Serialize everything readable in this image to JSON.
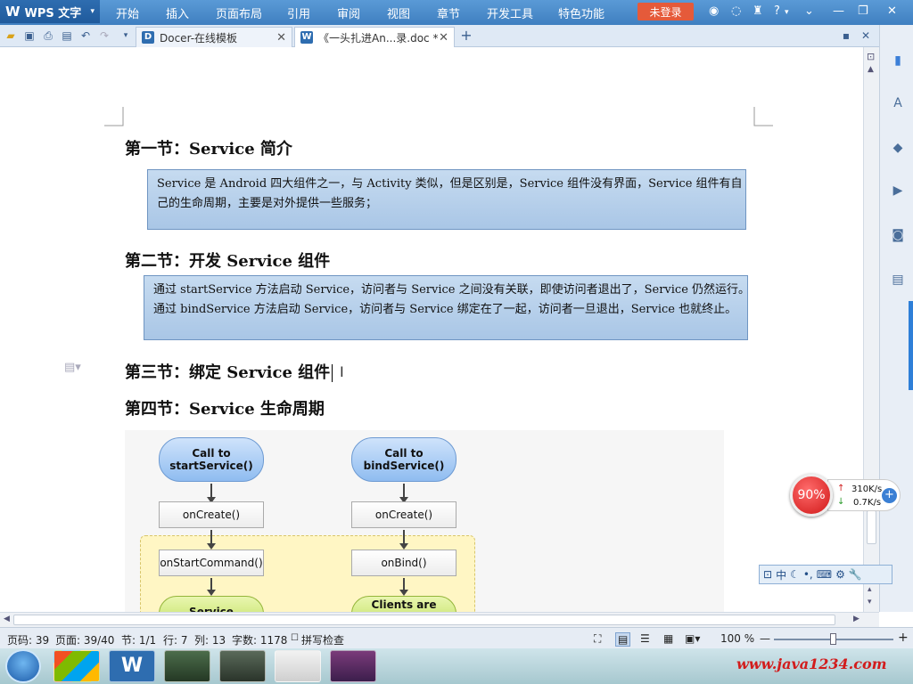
{
  "app": {
    "logo_text": "WPS 文字"
  },
  "menu": {
    "items": [
      "开始",
      "插入",
      "页面布局",
      "引用",
      "审阅",
      "视图",
      "章节",
      "开发工具",
      "特色功能"
    ],
    "login_label": "未登录",
    "help": "?"
  },
  "tabs": [
    {
      "label": "Docer-在线模板",
      "icon": "D"
    },
    {
      "label": "《一头扎进An...录.doc *",
      "icon": "W"
    }
  ],
  "document": {
    "sections": [
      {
        "heading": "第一节：Service 简介",
        "box_lines": [
          "Service 是 Android 四大组件之一，与 Activity 类似，但是区别是，Service 组件没有界面，Service 组件有自",
          "己的生命周期，主要是对外提供一些服务；"
        ]
      },
      {
        "heading": "第二节：开发 Service 组件",
        "box_lines": [
          "通过 startService 方法启动 Service，访问者与 Service 之间没有关联，即使访问者退出了，Service 仍然运行。",
          "通过 bindService 方法启动 Service，访问者与 Service 绑定在了一起，访问者一旦退出，Service 也就终止。"
        ]
      },
      {
        "heading": "第三节：绑定 Service 组件"
      },
      {
        "heading": "第四节：Service 生命周期"
      }
    ],
    "diagram": {
      "left": {
        "start": "Call to\nstartService()",
        "create": "onCreate()",
        "command": "onStartCommand()",
        "bottom": "Service"
      },
      "right": {
        "start": "Call to\nbindService()",
        "create": "onCreate()",
        "command": "onBind()",
        "bottom": "Clients are"
      }
    }
  },
  "status": {
    "page_no": "页码: 39",
    "page": "页面: 39/40",
    "section": "节: 1/1",
    "row": "行: 7",
    "col": "列: 13",
    "word_count": "字数: 1178",
    "spell_check": "拼写检查",
    "zoom": "100 %"
  },
  "widgets": {
    "speed_percent": "90%",
    "upload": "310K/s",
    "download": "0.7K/s",
    "ime_label": "中"
  },
  "taskbar": {
    "watermark": "www.java1234.com"
  }
}
